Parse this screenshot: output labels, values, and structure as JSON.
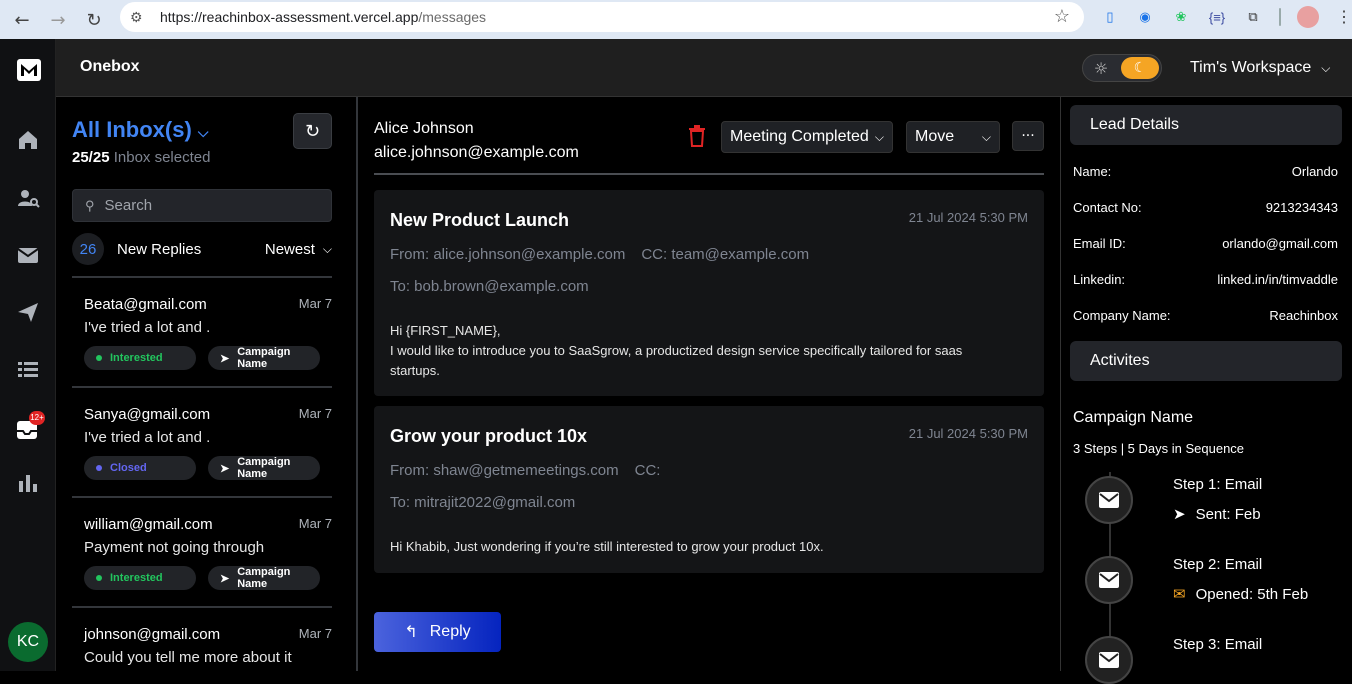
{
  "browser": {
    "url_host": "https://reachinbox-assessment.vercel.app",
    "url_path": "/messages"
  },
  "app": {
    "title": "Onebox",
    "workspace": "Tim's Workspace"
  },
  "inbox": {
    "title": "All Inbox(s)",
    "selected_count": "25/25",
    "selected_label": "Inbox selected",
    "search_placeholder": "Search",
    "new_count": "26",
    "new_label": "New Replies",
    "sort_label": "Newest",
    "mails": [
      {
        "email": "Beata@gmail.com",
        "date": "Mar 7",
        "snippet": "I've tried a lot and .",
        "status": "Interested",
        "status_color": "#22c55e",
        "campaign": "Campaign Name"
      },
      {
        "email": "Sanya@gmail.com",
        "date": "Mar 7",
        "snippet": "I've tried a lot and .",
        "status": "Closed",
        "status_color": "#6366f1",
        "campaign": "Campaign Name"
      },
      {
        "email": "william@gmail.com",
        "date": "Mar 7",
        "snippet": "Payment not going through",
        "status": "Interested",
        "status_color": "#22c55e",
        "campaign": "Campaign Name"
      },
      {
        "email": "johnson@gmail.com",
        "date": "Mar 7",
        "snippet": "Could you tell me more about it"
      }
    ]
  },
  "user": {
    "initials": "KC",
    "badge": "12+"
  },
  "thread": {
    "sender_name": "Alice Johnson",
    "sender_email": "alice.johnson@example.com",
    "status_select": "Meeting Completed",
    "move_select": "Move",
    "more": "···",
    "messages": [
      {
        "subject": "New Product Launch",
        "timestamp": "21 Jul 2024 5:30 PM",
        "from": "From: alice.johnson@example.com",
        "cc": "CC: team@example.com",
        "to": "To: bob.brown@example.com",
        "body_line1": "Hi {FIRST_NAME},",
        "body_line2": "I would like to introduce you to SaaSgrow, a productized design service specifically tailored for saas startups."
      },
      {
        "subject": "Grow your product 10x",
        "timestamp": "21 Jul 2024 5:30 PM",
        "from": "From: shaw@getmemeetings.com",
        "cc": "CC:",
        "to": "To: mitrajit2022@gmail.com",
        "body_line1": "Hi Khabib, Just wondering if you’re still interested to grow your product 10x."
      }
    ],
    "reply_label": "Reply"
  },
  "lead": {
    "title": "Lead Details",
    "fields": [
      {
        "label": "Name:",
        "value": "Orlando"
      },
      {
        "label": "Contact No:",
        "value": "9213234343"
      },
      {
        "label": "Email ID:",
        "value": "orlando@gmail.com"
      },
      {
        "label": "Linkedin:",
        "value": "linked.in/in/timvaddle"
      },
      {
        "label": "Company Name:",
        "value": "Reachinbox"
      }
    ]
  },
  "activities": {
    "title": "Activites",
    "campaign_name": "Campaign Name",
    "sequence": "3 Steps | 5 Days in Sequence",
    "steps": [
      {
        "title": "Step 1: Email",
        "status": "Sent: Feb"
      },
      {
        "title": "Step 2: Email",
        "status": "Opened: 5th Feb"
      },
      {
        "title": "Step 3: Email"
      }
    ]
  },
  "colors": {
    "accent_blue": "#4285f4",
    "reply_gradient_start": "#4b63dd",
    "reply_gradient_end": "#0524bf",
    "trash_red": "#e02424",
    "moon_orange": "#f5a524"
  }
}
